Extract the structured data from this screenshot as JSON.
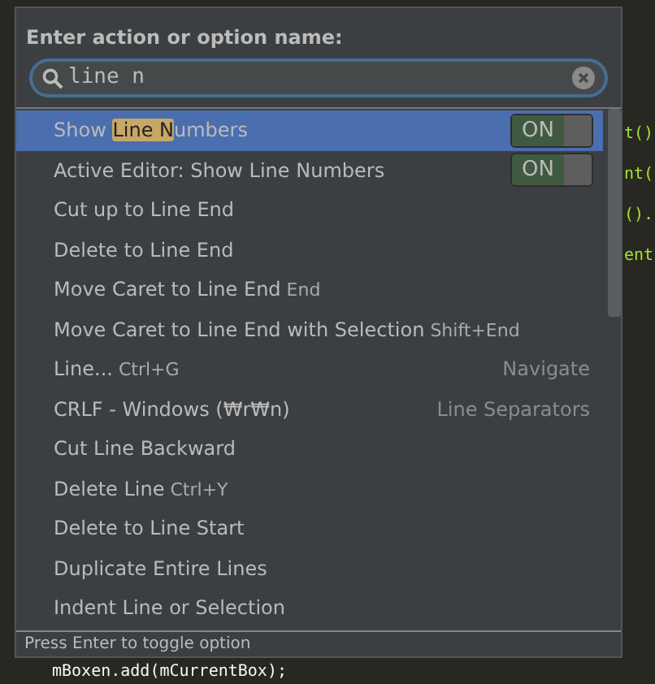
{
  "editor": {
    "right_fragments": [
      "t()",
      "nt(",
      "().",
      "ent"
    ],
    "line_bottom": "mBoxen.add(mCurrentBox);"
  },
  "popup": {
    "title": "Enter action or option name:",
    "search": {
      "value": "line n"
    },
    "rows": [
      {
        "kind": "toggle",
        "parts": [
          {
            "text": "Show ",
            "matched": false
          },
          {
            "text": "Line N",
            "matched": true
          },
          {
            "text": "umbers",
            "matched": false
          }
        ],
        "value": "ON",
        "on": true,
        "selected": true
      },
      {
        "kind": "toggle",
        "label": "Active Editor: Show Line Numbers",
        "value": "ON",
        "on": true,
        "selected": false
      },
      {
        "kind": "action",
        "label": "Cut up to Line End",
        "selected": false
      },
      {
        "kind": "action",
        "label": "Delete to Line End",
        "selected": false
      },
      {
        "kind": "action",
        "label": "Move Caret to Line End",
        "shortcut": "End",
        "selected": false
      },
      {
        "kind": "action",
        "label": "Move Caret to Line End with Selection",
        "shortcut": "Shift+End",
        "selected": false
      },
      {
        "kind": "action",
        "label": "Line...",
        "shortcut": "Ctrl+G",
        "group": "Navigate",
        "selected": false
      },
      {
        "kind": "action",
        "label": "CRLF - Windows (₩r₩n)",
        "group": "Line Separators",
        "selected": false
      },
      {
        "kind": "action",
        "label": "Cut Line Backward",
        "selected": false
      },
      {
        "kind": "action",
        "label": "Delete Line",
        "shortcut": "Ctrl+Y",
        "selected": false
      },
      {
        "kind": "action",
        "label": "Delete to Line Start",
        "selected": false
      },
      {
        "kind": "action",
        "label": "Duplicate Entire Lines",
        "selected": false
      },
      {
        "kind": "action",
        "label": "Indent Line or Selection",
        "selected": false
      }
    ],
    "footer": "Press Enter to toggle option"
  }
}
